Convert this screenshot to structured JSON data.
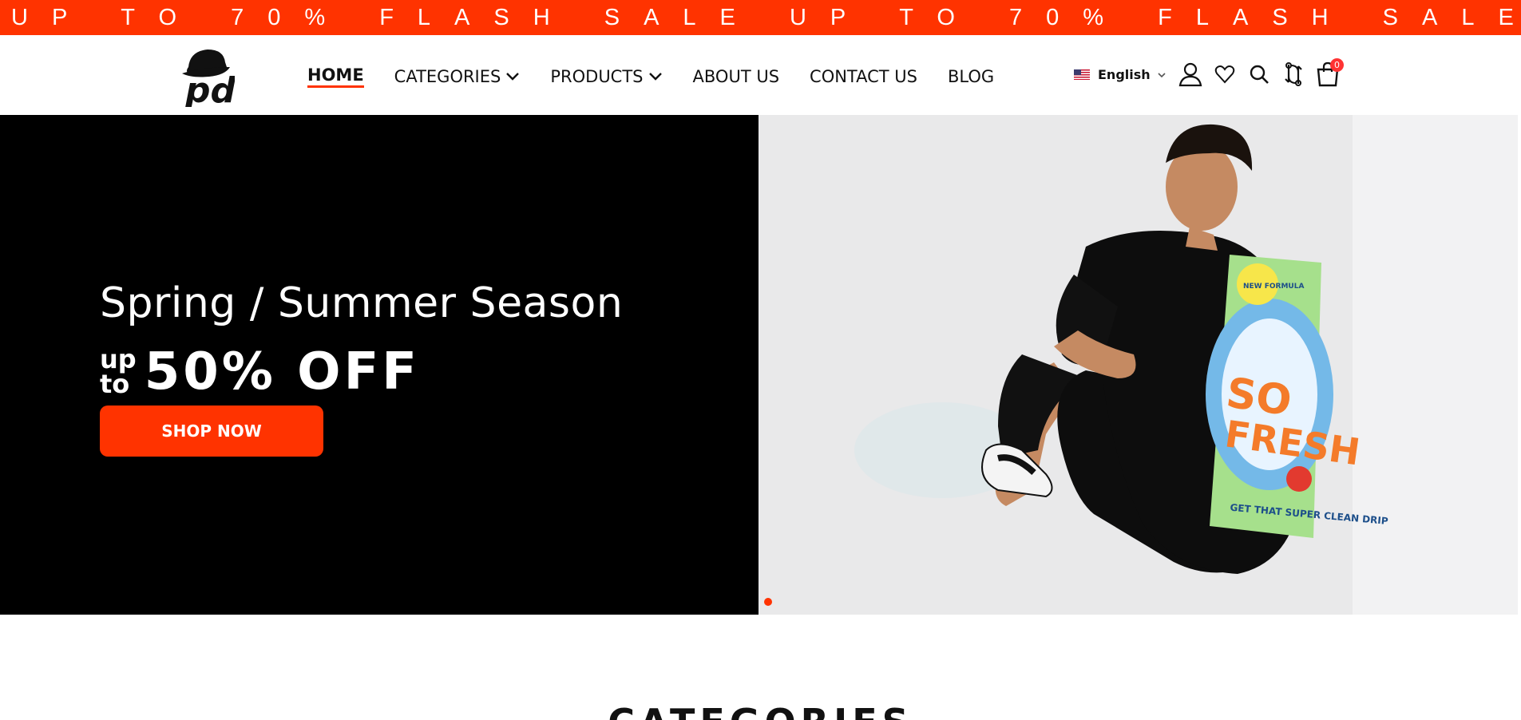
{
  "marquee": {
    "text": "UP TO 70% FLASH SALE UP TO 70% FLASH SALE UP T"
  },
  "header": {
    "logo_text": "pd",
    "nav": [
      {
        "label": "HOME",
        "active": true
      },
      {
        "label": "CATEGORIES",
        "dropdown": true
      },
      {
        "label": "PRODUCTS",
        "dropdown": true
      },
      {
        "label": "ABOUT US"
      },
      {
        "label": "CONTACT US"
      },
      {
        "label": "BLOG"
      }
    ],
    "language": {
      "label": "English",
      "flag": "us-flag-icon"
    },
    "icons": [
      "user-icon",
      "heart-icon",
      "search-icon",
      "compare-icon",
      "cart-icon"
    ],
    "cart_count": "0"
  },
  "hero": {
    "title": "Spring / Summer Season",
    "upto_top": "up",
    "upto_bottom": "to",
    "offer": "50% OFF",
    "cta": "SHOP NOW",
    "image_text": {
      "badge": "NEW FORMULA",
      "headline_1": "SO",
      "headline_2": "FRESH",
      "tagline": "GET THAT SUPER CLEAN DRIP"
    },
    "slide_dots": 1,
    "colors": {
      "accent": "#ff3300",
      "panel": "#000000",
      "photo_bg": "#e9e9ea"
    }
  },
  "sections": {
    "categories_title": "CATEGORIES"
  }
}
